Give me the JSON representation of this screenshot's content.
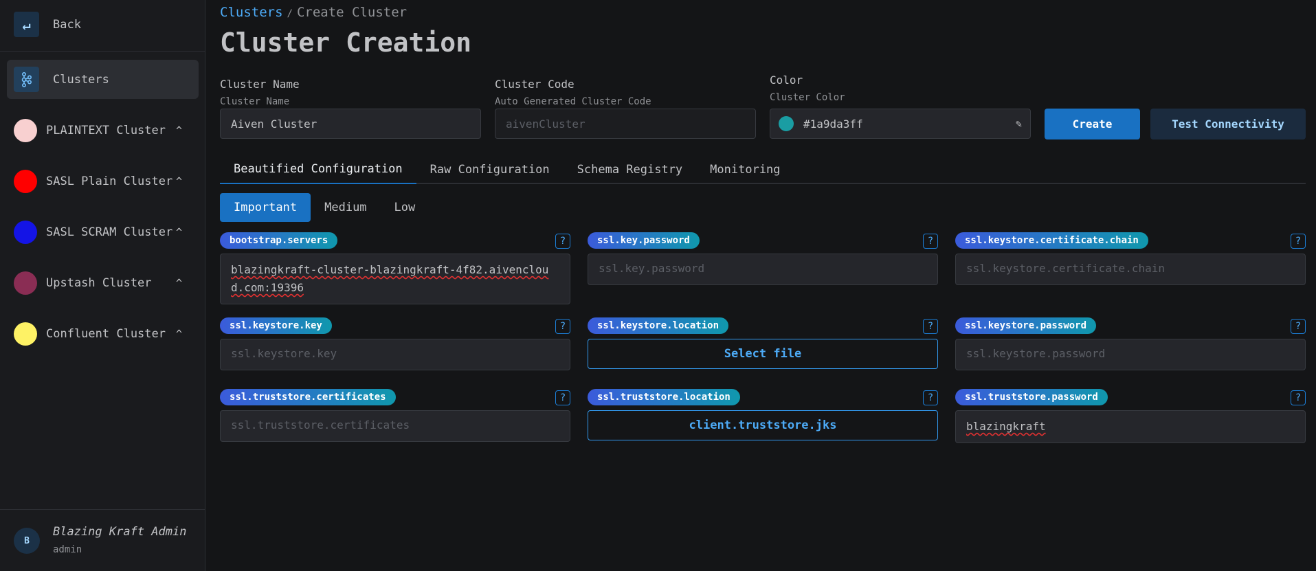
{
  "sidebar": {
    "back_label": "Back",
    "back_icon": "arrow-return-left-icon",
    "clusters_label": "Clusters",
    "clusters_icon": "kafka-icon",
    "clusters": [
      {
        "name": "PLAINTEXT Cluster",
        "color": "#f8d0d0"
      },
      {
        "name": "SASL Plain Cluster",
        "color": "#ff0000"
      },
      {
        "name": "SASL SCRAM Cluster",
        "color": "#1414e6"
      },
      {
        "name": "Upstash Cluster",
        "color": "#8a2d54"
      },
      {
        "name": "Confluent Cluster",
        "color": "#fef265"
      }
    ],
    "chevron": "^",
    "user": {
      "initial": "B",
      "name": "Blazing Kraft Admin",
      "role": "admin"
    }
  },
  "breadcrumb": {
    "link": "Clusters",
    "separator": "/",
    "current": "Create Cluster"
  },
  "page_title": "Cluster Creation",
  "form": {
    "cluster_name": {
      "label": "Cluster Name",
      "description": "Cluster Name",
      "value": "Aiven Cluster"
    },
    "cluster_code": {
      "label": "Cluster Code",
      "description": "Auto Generated Cluster Code",
      "placeholder": "aivenCluster"
    },
    "color": {
      "label": "Color",
      "description": "Cluster Color",
      "value": "#1a9da3ff",
      "swatch": "#1a9da3",
      "edit_icon": "pencil-icon"
    },
    "create_label": "Create",
    "test_label": "Test Connectivity"
  },
  "tabs": [
    {
      "label": "Beautified Configuration",
      "active": true
    },
    {
      "label": "Raw Configuration",
      "active": false
    },
    {
      "label": "Schema Registry",
      "active": false
    },
    {
      "label": "Monitoring",
      "active": false
    }
  ],
  "subtabs": [
    {
      "label": "Important",
      "active": true
    },
    {
      "label": "Medium",
      "active": false
    },
    {
      "label": "Low",
      "active": false
    }
  ],
  "help_label": "?",
  "config": [
    {
      "key": "bootstrap.servers",
      "type": "text",
      "value": "blazingkraft-cluster-blazingkraft-4f82.aivencloud.com:19396"
    },
    {
      "key": "ssl.key.password",
      "type": "text",
      "placeholder": "ssl.key.password"
    },
    {
      "key": "ssl.keystore.certificate.chain",
      "type": "text",
      "placeholder": "ssl.keystore.certificate.chain"
    },
    {
      "key": "ssl.keystore.key",
      "type": "text",
      "placeholder": "ssl.keystore.key"
    },
    {
      "key": "ssl.keystore.location",
      "type": "file",
      "value": "Select file"
    },
    {
      "key": "ssl.keystore.password",
      "type": "text",
      "placeholder": "ssl.keystore.password"
    },
    {
      "key": "ssl.truststore.certificates",
      "type": "text",
      "placeholder": "ssl.truststore.certificates"
    },
    {
      "key": "ssl.truststore.location",
      "type": "file",
      "value": "client.truststore.jks"
    },
    {
      "key": "ssl.truststore.password",
      "type": "text",
      "value": "blazingkraft"
    }
  ]
}
